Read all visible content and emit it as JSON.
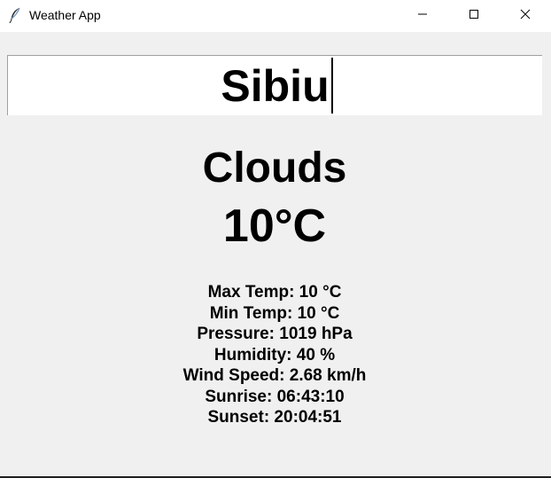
{
  "window": {
    "title": "Weather App",
    "icon": "feather-icon",
    "controls": [
      "minimize-icon",
      "maximize-icon",
      "close-icon"
    ]
  },
  "search": {
    "value": "Sibiu"
  },
  "weather": {
    "condition": "Clouds",
    "temperature": "10°C",
    "details": [
      "Max Temp: 10 °C",
      "Min Temp: 10 °C",
      "Pressure: 1019 hPa",
      "Humidity: 40 %",
      "Wind Speed: 2.68 km/h",
      "Sunrise: 06:43:10",
      "Sunset: 20:04:51"
    ]
  }
}
